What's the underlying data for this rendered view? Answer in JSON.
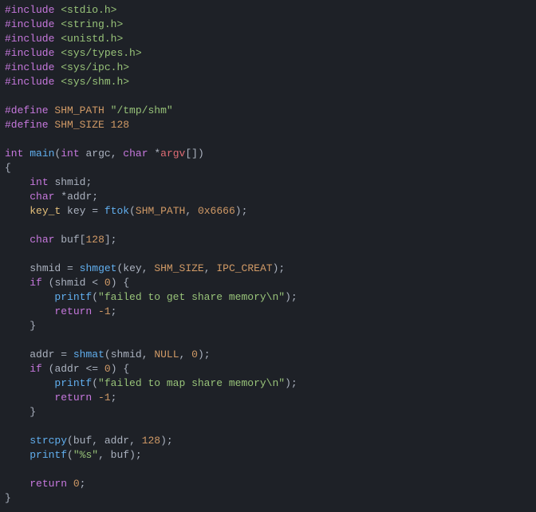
{
  "code": {
    "inc1_kw": "#include",
    "inc1_h": "<stdio.h>",
    "inc2_kw": "#include",
    "inc2_h": "<string.h>",
    "inc3_kw": "#include",
    "inc3_h": "<unistd.h>",
    "inc4_kw": "#include",
    "inc4_h": "<sys/types.h>",
    "inc5_kw": "#include",
    "inc5_h": "<sys/ipc.h>",
    "inc6_kw": "#include",
    "inc6_h": "<sys/shm.h>",
    "def1_kw": "#define",
    "def1_name": "SHM_PATH",
    "def1_val": "\"/tmp/shm\"",
    "def2_kw": "#define",
    "def2_name": "SHM_SIZE",
    "def2_val": "128",
    "fn_ret": "int",
    "fn_name": "main",
    "p1_t": "int",
    "p1_n": "argc",
    "p2_t": "char",
    "p2_star": "*",
    "p2_n": "argv",
    "p2_br": "[]",
    "d1_t": "int",
    "d1_n": "shmid",
    "d2_t": "char",
    "d2_star": "*",
    "d2_n": "addr",
    "d3_t": "key_t",
    "d3_n": "key",
    "d3_eq": "=",
    "d3_fn": "ftok",
    "d3_a1": "SHM_PATH",
    "d3_a2": "0x6666",
    "d4_t": "char",
    "d4_n": "buf",
    "d4_sz": "128",
    "a1_l": "shmid",
    "a1_eq": "=",
    "a1_fn": "shmget",
    "a1_p1": "key",
    "a1_p2": "SHM_SIZE",
    "a1_p3": "IPC_CREAT",
    "if1_kw": "if",
    "if1_l": "shmid",
    "if1_op": "<",
    "if1_r": "0",
    "pf1_fn": "printf",
    "pf1_s": "\"failed to get share memory\\n\"",
    "ret1_kw": "return",
    "ret1_v": "-1",
    "a2_l": "addr",
    "a2_eq": "=",
    "a2_fn": "shmat",
    "a2_p1": "shmid",
    "a2_p2": "NULL",
    "a2_p3": "0",
    "if2_kw": "if",
    "if2_l": "addr",
    "if2_op": "<=",
    "if2_r": "0",
    "pf2_fn": "printf",
    "pf2_s": "\"failed to map share memory\\n\"",
    "ret2_kw": "return",
    "ret2_v": "-1",
    "sc_fn": "strcpy",
    "sc_p1": "buf",
    "sc_p2": "addr",
    "sc_p3": "128",
    "pf3_fn": "printf",
    "pf3_s": "\"%s\"",
    "pf3_p2": "buf",
    "ret3_kw": "return",
    "ret3_v": "0"
  }
}
